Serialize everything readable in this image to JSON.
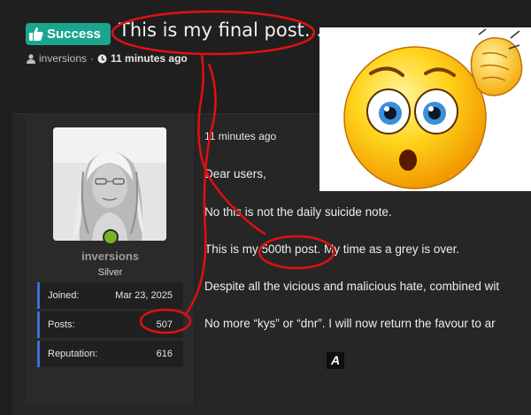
{
  "thread": {
    "prefix": "Success",
    "title": "This is my final post...",
    "author": "inversions",
    "separator": "·",
    "time_ago": "11 minutes ago"
  },
  "user": {
    "username": "inversions",
    "rank": "Silver",
    "stats": [
      {
        "label": "Joined:",
        "value": "Mar 23, 2025"
      },
      {
        "label": "Posts:",
        "value": "507"
      },
      {
        "label": "Reputation:",
        "value": "616"
      }
    ]
  },
  "post": {
    "time_ago": "11 minutes ago",
    "lines": [
      "Dear users,",
      "No this is not the daily suicide note.",
      "This is my 500th post. My time as a grey is over.",
      "Despite all the vicious and malicious hate, combined wit",
      "No more “kys” or “dnr”. I will now return the favour to ar"
    ],
    "quote_glyph": "A"
  },
  "colors": {
    "prefix_bg": "#1aa58f",
    "annotation": "#e01010",
    "online": "#78b420",
    "stat_accent": "#3d6fd6"
  },
  "icons": [
    "thumbs-up-icon",
    "user-icon",
    "clock-icon",
    "quote-icon",
    "confused-emoji"
  ]
}
